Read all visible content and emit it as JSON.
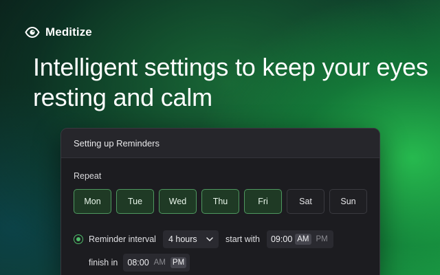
{
  "brand": {
    "name": "Meditize",
    "icon": "eye-icon"
  },
  "headline": "Intelligent settings to keep your eyes resting and calm",
  "card": {
    "title": "Setting up Reminders",
    "repeat_label": "Repeat",
    "days": [
      {
        "label": "Mon",
        "selected": true
      },
      {
        "label": "Tue",
        "selected": true
      },
      {
        "label": "Wed",
        "selected": true
      },
      {
        "label": "Thu",
        "selected": true
      },
      {
        "label": "Fri",
        "selected": true
      },
      {
        "label": "Sat",
        "selected": false
      },
      {
        "label": "Sun",
        "selected": false
      }
    ],
    "reminder_interval_label": "Reminder interval",
    "interval_value": "4 hours",
    "start_with_label": "start with",
    "start_time": {
      "value": "09:00",
      "am": "AM",
      "pm": "PM",
      "selected": "AM"
    },
    "finish_in_label": "finish in",
    "finish_time": {
      "value": "08:00",
      "am": "AM",
      "pm": "PM",
      "selected": "PM"
    }
  },
  "colors": {
    "accent": "#4fbf6a",
    "selected_day_bg": "#1f3a25",
    "card_bg": "#1c1c20"
  }
}
